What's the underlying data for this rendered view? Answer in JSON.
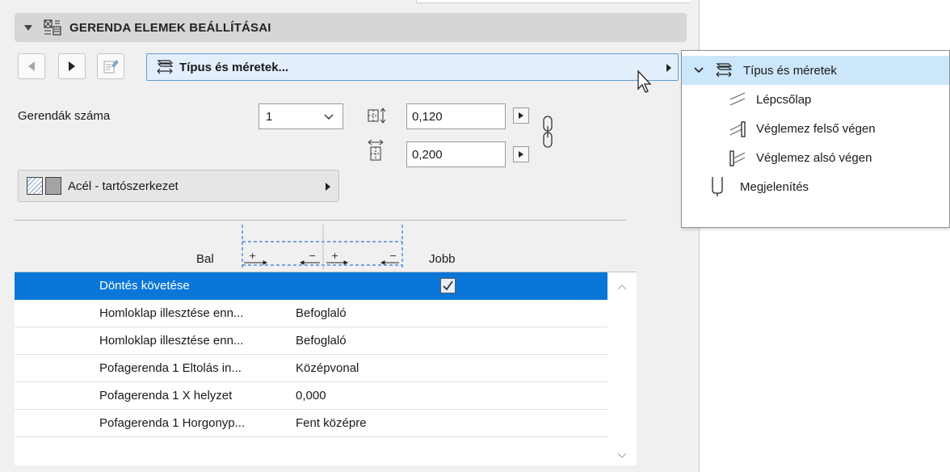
{
  "panel": {
    "title": "GERENDA ELEMEK BEÁLLÍTÁSAI",
    "type_selector_label": "Típus és méretek...",
    "count_label": "Gerendák száma",
    "count_value": "1",
    "width_value": "0,120",
    "height_value": "0,200",
    "material_label": "Acél - tartószerkezet"
  },
  "table": {
    "left_label": "Bal",
    "right_label": "Jobb",
    "rows": [
      {
        "name": "Döntés követése",
        "value": "",
        "checked": true
      },
      {
        "name": "Homloklap illesztése enn...",
        "value": "Befoglaló"
      },
      {
        "name": "Homloklap illesztése enn...",
        "value": "Befoglaló"
      },
      {
        "name": "Pofagerenda 1 Eltolás in...",
        "value": "Középvonal"
      },
      {
        "name": "Pofagerenda 1 X helyzet",
        "value": " 0,000"
      },
      {
        "name": "Pofagerenda 1 Horgonyp...",
        "value": "Fent középre"
      }
    ]
  },
  "menu": {
    "items": [
      {
        "label": "Típus és méretek",
        "icon": "beam-size-icon",
        "checked": true
      },
      {
        "label": "Lépcsőlap",
        "icon": "stair-tread-icon"
      },
      {
        "label": "Véglemez felső végen",
        "icon": "end-plate-top-icon"
      },
      {
        "label": "Véglemez alsó végen",
        "icon": "end-plate-bottom-icon"
      },
      {
        "label": "Megjelenítés",
        "icon": "display-icon"
      }
    ]
  },
  "colors": {
    "selection": "#0a77d8",
    "menu_highlight": "#cce6fa",
    "dropdown_bg": "#e3effb",
    "dropdown_border": "#5a9ad8"
  }
}
